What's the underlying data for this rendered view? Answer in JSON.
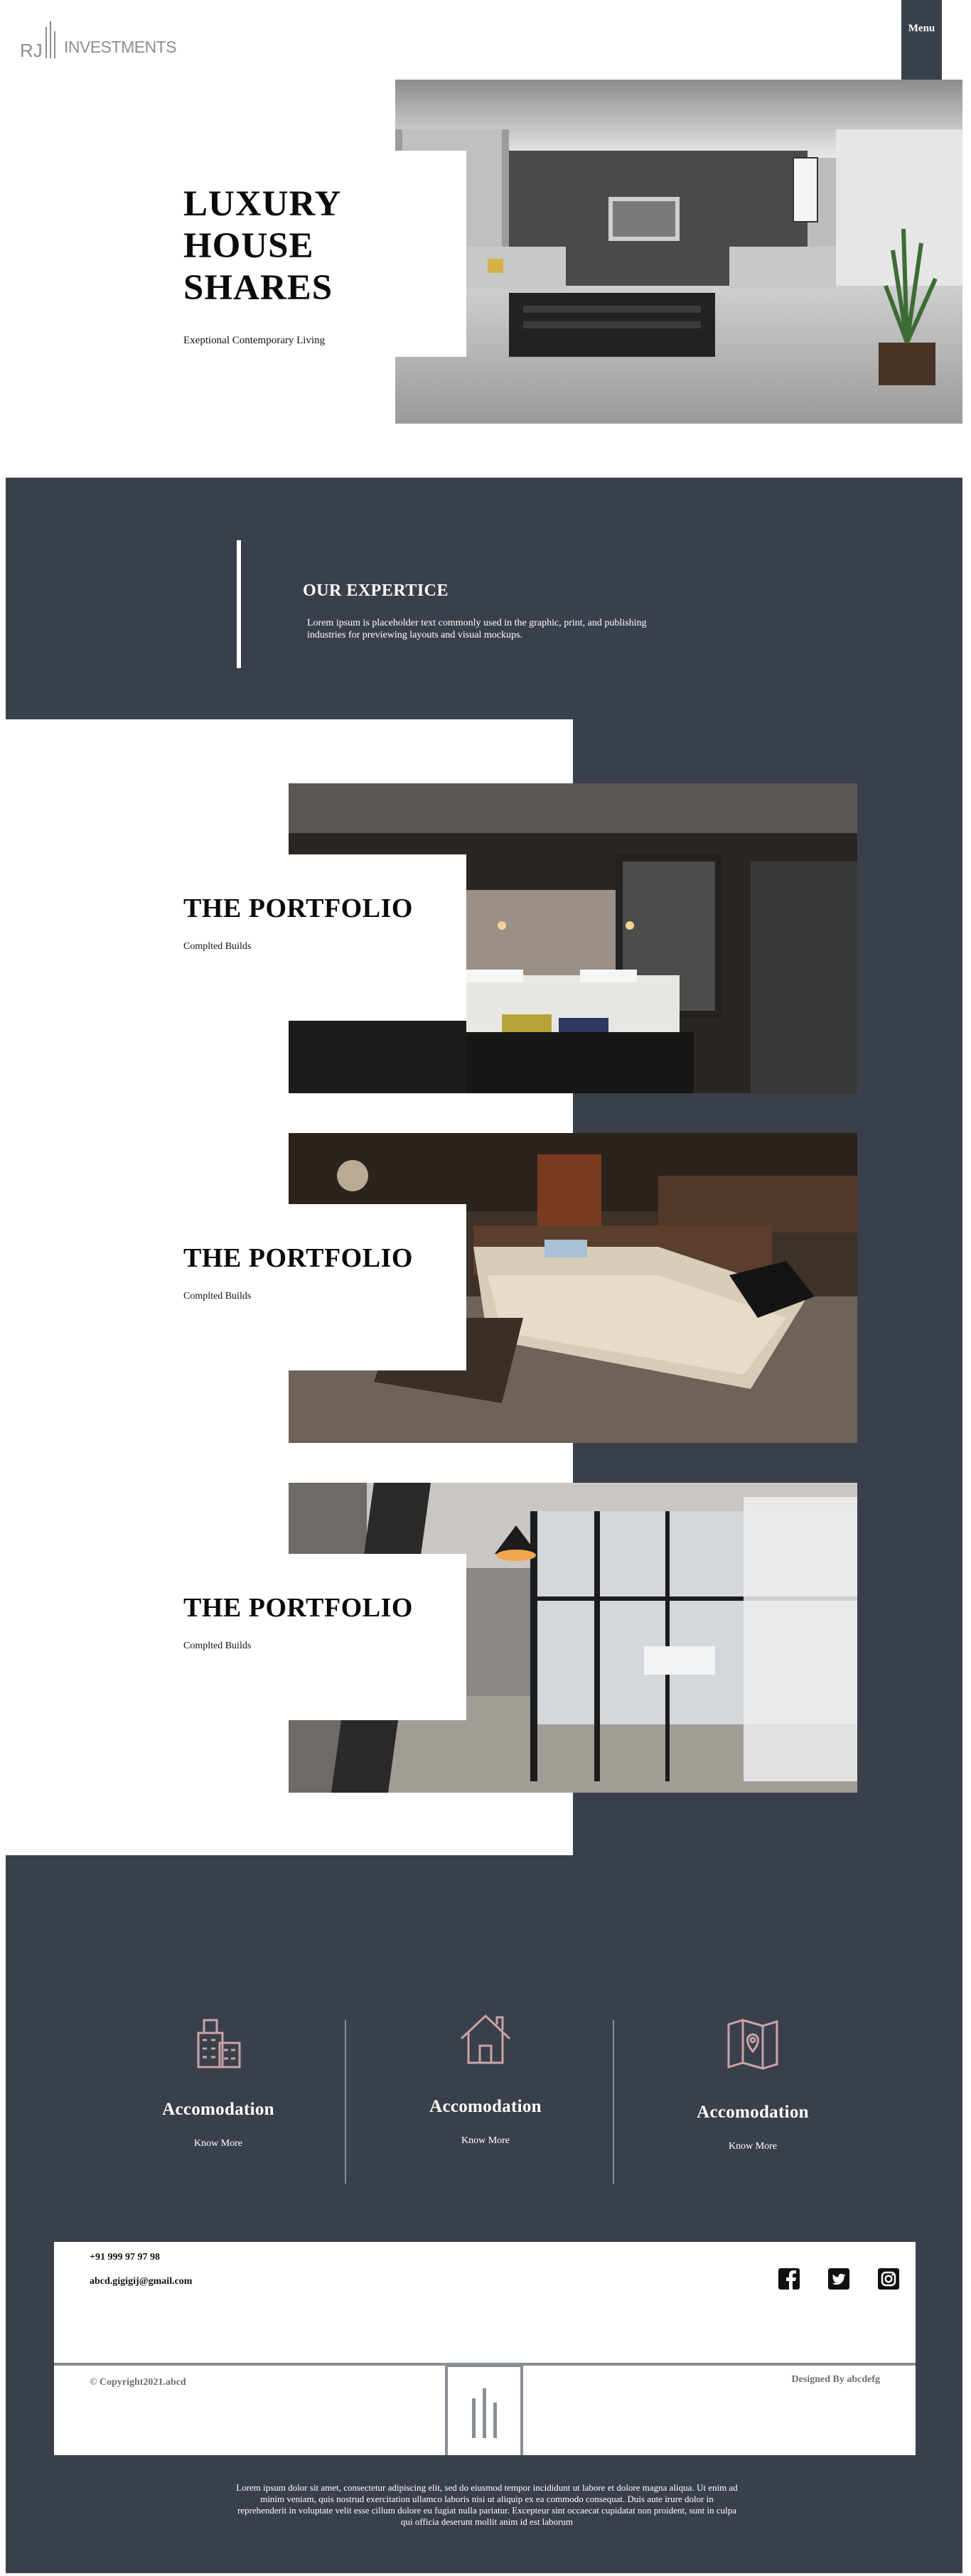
{
  "header": {
    "logo_text": "INVESTMENTS",
    "menu_label": "Menu"
  },
  "hero": {
    "title_line1": "LUXURY",
    "title_line2": "HOUSE",
    "title_line3": "SHARES",
    "subtitle": "Exeptional Contemporary Living"
  },
  "expertise": {
    "title": "OUR EXPERTICE",
    "text": "Lorem ipsum is placeholder text commonly used in the graphic, print, and publishing industries for previewing layouts and visual mockups."
  },
  "portfolio": [
    {
      "title": "THE PORTFOLIO",
      "subtitle": "Complted Builds"
    },
    {
      "title": "THE PORTFOLIO",
      "subtitle": "Complted Builds"
    },
    {
      "title": "THE PORTFOLIO",
      "subtitle": "Complted Builds"
    }
  ],
  "services": [
    {
      "icon": "buildings-icon",
      "title": "Accomodation",
      "link": "Know More"
    },
    {
      "icon": "house-icon",
      "title": "Accomodation",
      "link": "Know More"
    },
    {
      "icon": "map-pin-icon",
      "title": "Accomodation",
      "link": "Know More"
    }
  ],
  "footer": {
    "phone": "+91 999 97 97 98",
    "email": "abcd.gigigij@gmail.com",
    "social": [
      "facebook-icon",
      "twitter-icon",
      "instagram-icon"
    ],
    "copyright": "© Copyright2021.abcd",
    "designed_by": "Designed By abcdefg"
  },
  "bottom_text": "Lorem ipsum dolor sit amet, consectetur adipiscing elit, sed do eiusmod tempor incididunt ut labore et dolore magna aliqua. Ut enim ad minim veniam, quis nostrud exercitation ullamco laboris nisi ut aliquip ex ea commodo consequat. Duis aute irure dolor in reprehenderit in voluptate velit esse cillum dolore eu fugiat nulla pariatur. Excepteur sint occaecat cupidatat non proident, sunt in culpa qui officia deserunt mollit anim id est laborum",
  "colors": {
    "dark_slate": "#3a404b",
    "logo_gray": "#8a8e95",
    "icon_pink": "#c8a4a6"
  }
}
